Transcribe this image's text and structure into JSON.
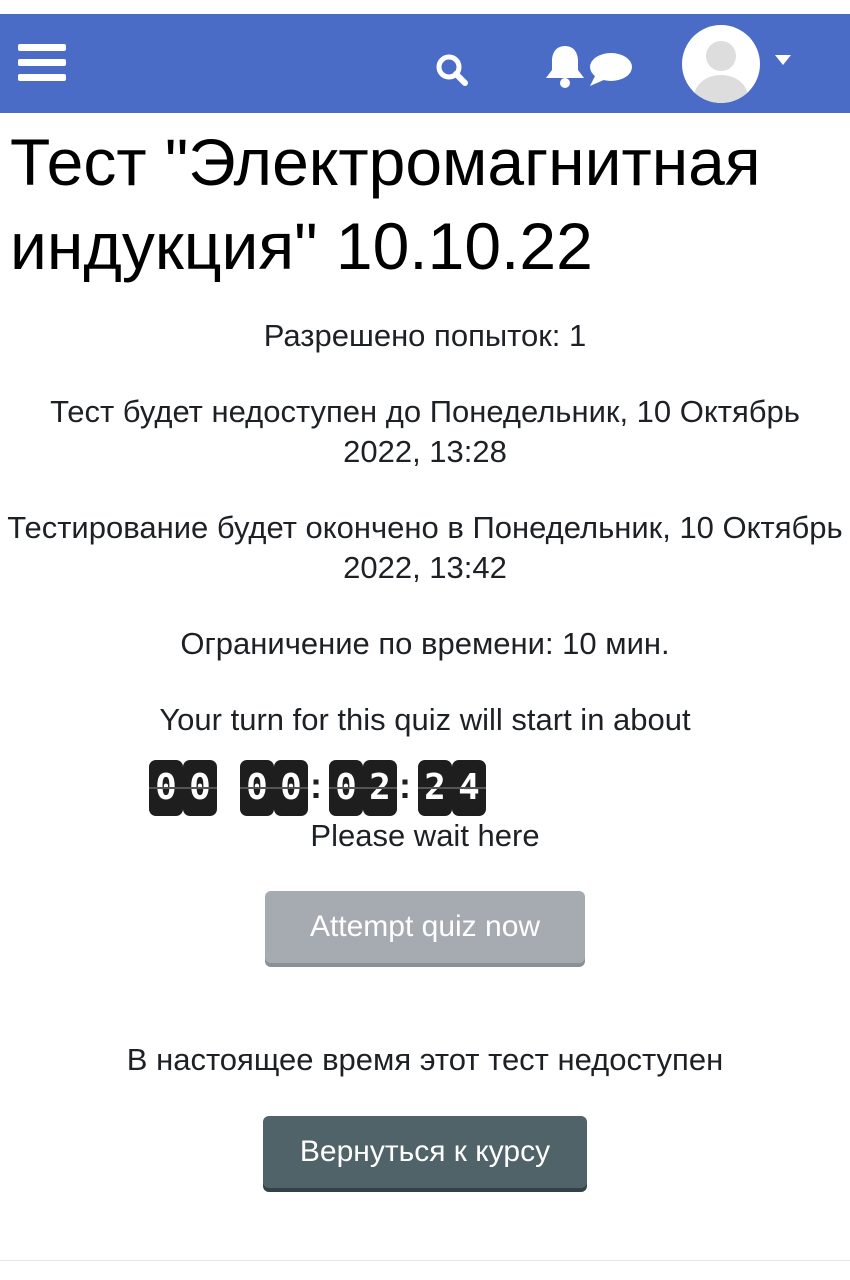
{
  "navbar": {
    "menu_icon": "hamburger-menu-icon",
    "search_icon": "search-icon",
    "notifications_icon": "bell-icon",
    "messages_icon": "chat-bubble-icon",
    "avatar_icon": "user-avatar-icon",
    "usermenu_icon": "caret-down-icon",
    "color": "#4a6cc7"
  },
  "page": {
    "title": "Тест \"Электромагнитная индукция\" 10.10.22"
  },
  "quiz_info": {
    "attempts_allowed": "Разрешено попыток: 1",
    "opens": "Тест будет недоступен до Понедельник, 10 Октябрь 2022, 13:28",
    "closes": "Тестирование будет окончено в Понедельник, 10 Октябрь 2022, 13:42",
    "time_limit": "Ограничение по времени: 10 мин."
  },
  "countdown": {
    "caption": "Your turn for this quiz will start in about",
    "days": "00",
    "hours": "00",
    "minutes": "02",
    "seconds": "24",
    "separator": ":",
    "wait_text": "Please wait here"
  },
  "actions": {
    "attempt_label": "Attempt quiz now",
    "unavailable_text": "В настоящее время этот тест недоступен",
    "back_label": "Вернуться к курсу"
  }
}
